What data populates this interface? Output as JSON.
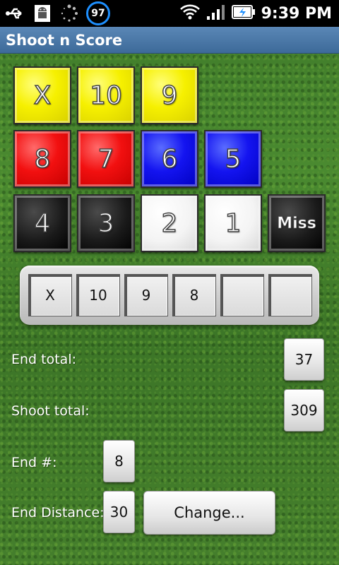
{
  "status_bar": {
    "battery_badge": "97",
    "time": "9:39 PM",
    "icons": [
      "usb-icon",
      "android-icon",
      "loading-icon",
      "battery-level-badge",
      "wifi-icon",
      "signal-icon",
      "battery-charging-icon"
    ]
  },
  "app": {
    "title": "Shoot n Score"
  },
  "score_buttons": {
    "row1": [
      "X",
      "10",
      "9"
    ],
    "row2": [
      "8",
      "7",
      "6",
      "5"
    ],
    "row3": [
      "4",
      "3",
      "2",
      "1",
      "Miss"
    ]
  },
  "end_arrows": [
    "X",
    "10",
    "9",
    "8",
    "",
    ""
  ],
  "fields": {
    "end_total_label": "End total:",
    "end_total_value": "37",
    "shoot_total_label": "Shoot total:",
    "shoot_total_value": "309",
    "end_number_label": "End #:",
    "end_number_value": "8",
    "end_distance_label": "End Distance:",
    "end_distance_value": "30",
    "change_button": "Change..."
  },
  "colors": {
    "gold": "#f6f000",
    "red": "#f21010",
    "blue": "#1414f0",
    "black": "#1a1a1a",
    "white": "#f4f4f4",
    "title_bar": "#4a79a8"
  }
}
